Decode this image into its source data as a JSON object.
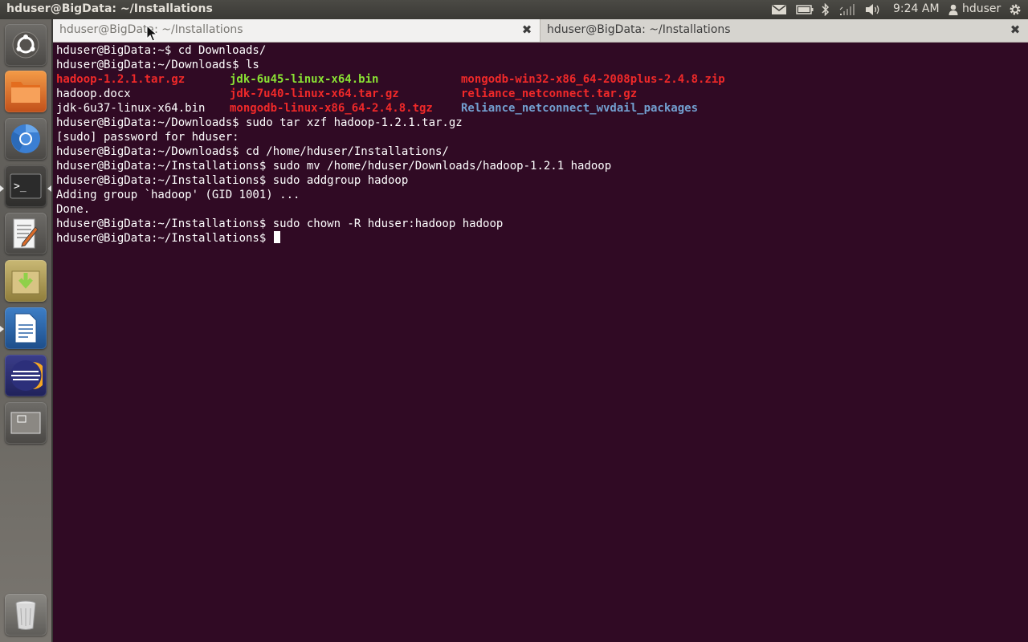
{
  "panel": {
    "window_title": "hduser@BigData: ~/Installations",
    "clock": "9:24 AM",
    "user": "hduser",
    "icons": [
      "mail-icon",
      "battery-icon",
      "bluetooth-icon",
      "network-icon",
      "volume-icon",
      "user-icon",
      "gear-icon"
    ]
  },
  "launcher": {
    "items": [
      "dash-home-icon",
      "files-icon",
      "chromium-icon",
      "terminal-icon",
      "text-editor-icon",
      "archive-manager-icon",
      "writer-icon",
      "eclipse-icon",
      "workspace-switcher-icon",
      "trash-icon"
    ]
  },
  "terminal": {
    "tabs": [
      {
        "label": "hduser@BigData: ~/Installations",
        "active": true
      },
      {
        "label": "hduser@BigData: ~/Installations",
        "active": false
      }
    ],
    "lines": [
      "hduser@BigData:~$ cd Downloads/",
      "hduser@BigData:~/Downloads$ ls"
    ],
    "ls_rows": [
      [
        {
          "text": "hadoop-1.2.1.tar.gz",
          "color": "red"
        },
        {
          "text": "jdk-6u45-linux-x64.bin",
          "color": "green"
        },
        {
          "text": "mongodb-win32-x86_64-2008plus-2.4.8.zip",
          "color": "red"
        }
      ],
      [
        {
          "text": "hadoop.docx",
          "color": "white"
        },
        {
          "text": "jdk-7u40-linux-x64.tar.gz",
          "color": "red"
        },
        {
          "text": "reliance_netconnect.tar.gz",
          "color": "red"
        }
      ],
      [
        {
          "text": "jdk-6u37-linux-x64.bin",
          "color": "white"
        },
        {
          "text": "mongodb-linux-x86_64-2.4.8.tgz",
          "color": "red"
        },
        {
          "text": "Reliance_netconnect_wvdail_packages",
          "color": "blue"
        }
      ]
    ],
    "lines_after": [
      "hduser@BigData:~/Downloads$ sudo tar xzf hadoop-1.2.1.tar.gz",
      "[sudo] password for hduser:",
      "hduser@BigData:~/Downloads$ cd /home/hduser/Installations/",
      "hduser@BigData:~/Installations$ sudo mv /home/hduser/Downloads/hadoop-1.2.1 hadoop",
      "hduser@BigData:~/Installations$ sudo addgroup hadoop",
      "Adding group `hadoop' (GID 1001) ...",
      "Done.",
      "hduser@BigData:~/Installations$ sudo chown -R hduser:hadoop hadoop"
    ],
    "prompt": "hduser@BigData:~/Installations$ "
  },
  "colors": {
    "terminal_bg": "#300a24",
    "red": "#ef2929",
    "green": "#8ae234",
    "blue": "#729fcf"
  }
}
